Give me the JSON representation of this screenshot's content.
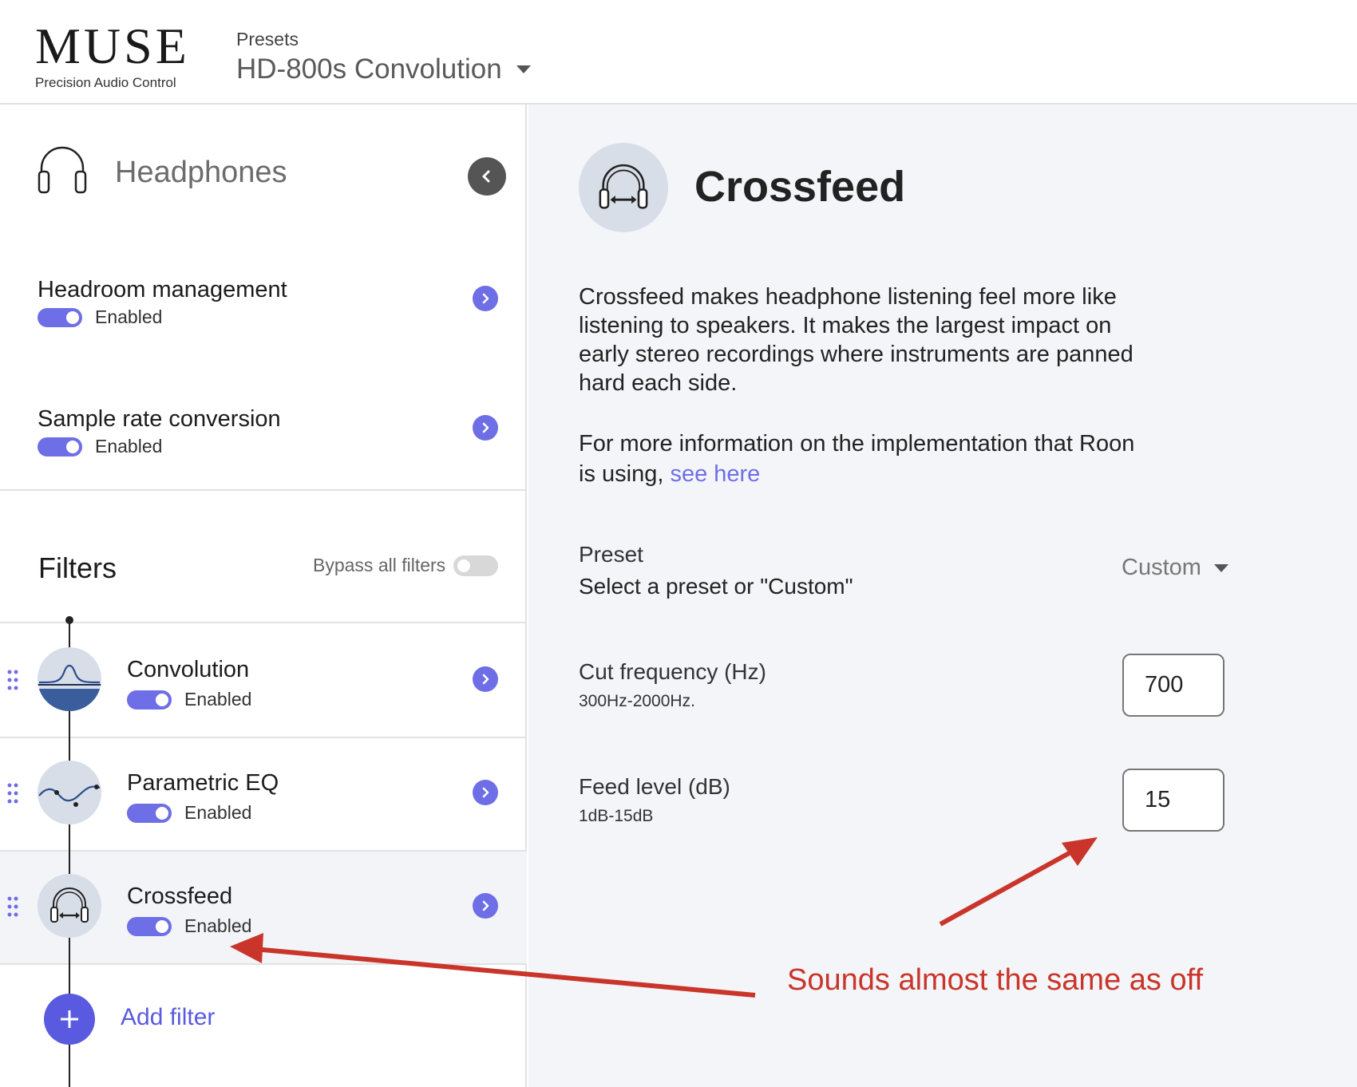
{
  "header": {
    "logo_word": "MUSE",
    "logo_tagline": "Precision Audio Control",
    "presets_label": "Presets",
    "preset_value": "HD-800s Convolution"
  },
  "sidebar": {
    "device_title": "Headphones",
    "settings": [
      {
        "title": "Headroom management",
        "status": "Enabled",
        "enabled": true
      },
      {
        "title": "Sample rate conversion",
        "status": "Enabled",
        "enabled": true
      }
    ],
    "filters_title": "Filters",
    "bypass_label": "Bypass all filters",
    "bypass_enabled": false,
    "filters": [
      {
        "name": "Convolution",
        "status": "Enabled",
        "enabled": true,
        "icon": "convolution-icon"
      },
      {
        "name": "Parametric EQ",
        "status": "Enabled",
        "enabled": true,
        "icon": "parametric-eq-icon"
      },
      {
        "name": "Crossfeed",
        "status": "Enabled",
        "enabled": true,
        "icon": "crossfeed-icon",
        "selected": true
      }
    ],
    "add_filter_label": "Add filter"
  },
  "detail": {
    "title": "Crossfeed",
    "description": "Crossfeed makes headphone listening feel more like listening to speakers. It makes the largest impact on early stereo recordings where instruments are panned hard each side.",
    "more_info_text": "For more information on the implementation that Roon is using,",
    "link_text": "see here",
    "preset_label": "Preset",
    "preset_sub": "Select a preset or \"Custom\"",
    "preset_value": "Custom",
    "cut_frequency_label": "Cut frequency (Hz)",
    "cut_frequency_range": "300Hz-2000Hz.",
    "cut_frequency_value": "700",
    "feed_level_label": "Feed level (dB)",
    "feed_level_range": "1dB-15dB",
    "feed_level_value": "15"
  },
  "annotation": {
    "text": "Sounds almost the same as off",
    "color": "#c9352a"
  },
  "colors": {
    "accent": "#6e6ee6",
    "add_button": "#5a5ae0",
    "icon_circle": "#d7dee8",
    "right_bg": "#f4f5f8"
  }
}
